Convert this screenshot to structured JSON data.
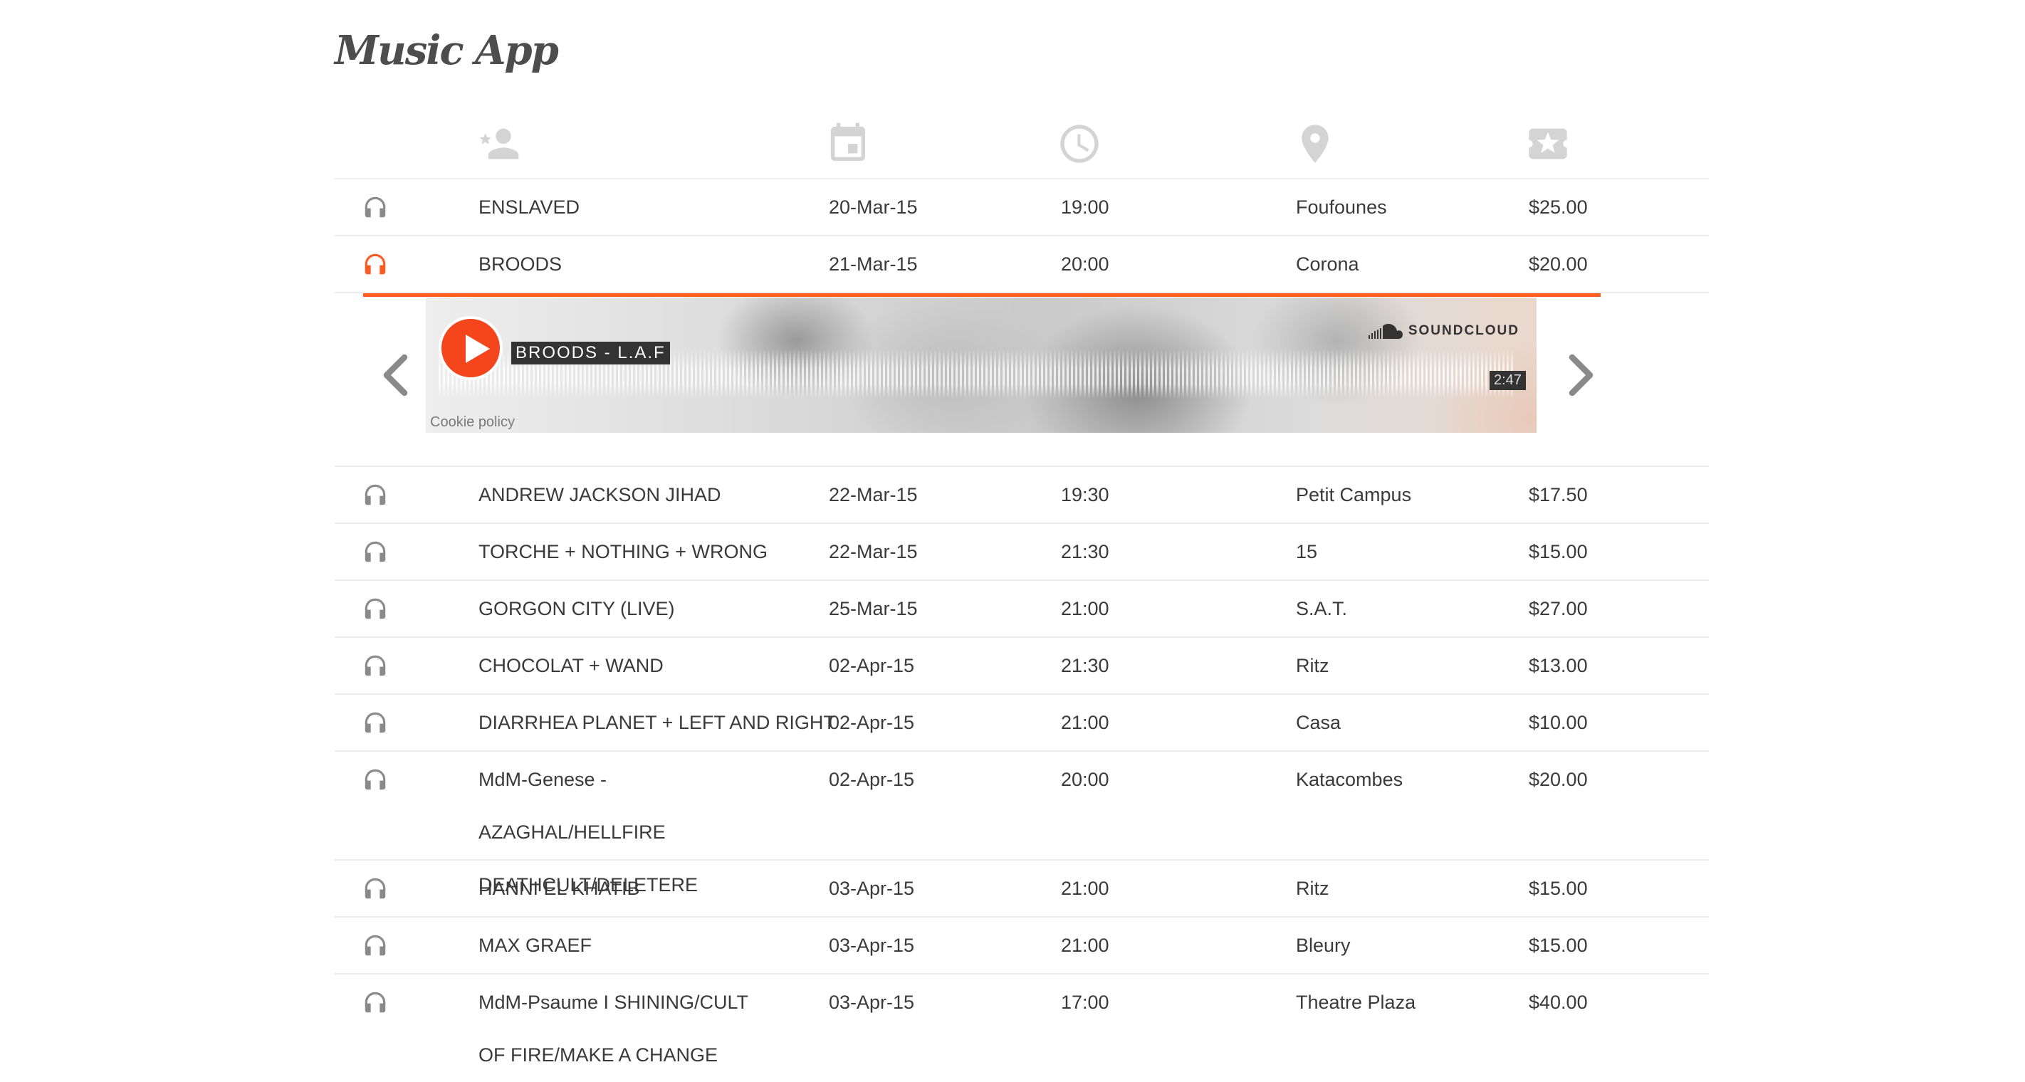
{
  "app": {
    "title": "Music App"
  },
  "header_icons": [
    "person-add-icon",
    "calendar-icon",
    "clock-icon",
    "location-pin-icon",
    "ticket-icon"
  ],
  "colors": {
    "accent": "#ff5a1f",
    "soundcloud_orange": "#f5451d",
    "icon_gray": "#d4d4d4",
    "text": "#3a3a3a"
  },
  "events": [
    {
      "artist": "ENSLAVED",
      "date": "20-Mar-15",
      "time": "19:00",
      "venue": "Foufounes",
      "price": "$25.00"
    },
    {
      "artist": "BROODS",
      "date": "21-Mar-15",
      "time": "20:00",
      "venue": "Corona",
      "price": "$20.00"
    },
    {
      "artist": "ANDREW JACKSON JIHAD",
      "date": "22-Mar-15",
      "time": "19:30",
      "venue": "Petit Campus",
      "price": "$17.50"
    },
    {
      "artist": "TORCHE + NOTHING + WRONG",
      "date": "22-Mar-15",
      "time": "21:30",
      "venue": "15",
      "price": "$15.00"
    },
    {
      "artist": "GORGON CITY (LIVE)",
      "date": "25-Mar-15",
      "time": "21:00",
      "venue": "S.A.T.",
      "price": "$27.00"
    },
    {
      "artist": "CHOCOLAT + WAND",
      "date": "02-Apr-15",
      "time": "21:30",
      "venue": "Ritz",
      "price": "$13.00"
    },
    {
      "artist": "DIARRHEA PLANET + LEFT AND RIGHT",
      "date": "02-Apr-15",
      "time": "21:00",
      "venue": "Casa",
      "price": "$10.00"
    },
    {
      "artist": "MdM-Genese - AZAGHAL/HELLFIRE DEATHCULT/DELETERE",
      "date": "02-Apr-15",
      "time": "20:00",
      "venue": "Katacombes",
      "price": "$20.00"
    },
    {
      "artist": "HANNI EL KHATIB",
      "date": "03-Apr-15",
      "time": "21:00",
      "venue": "Ritz",
      "price": "$15.00"
    },
    {
      "artist": "MAX GRAEF",
      "date": "03-Apr-15",
      "time": "21:00",
      "venue": "Bleury",
      "price": "$15.00"
    },
    {
      "artist": "MdM-Psaume I SHINING/CULT OF FIRE/MAKE A CHANGE",
      "date": "03-Apr-15",
      "time": "17:00",
      "venue": "Theatre Plaza",
      "price": "$40.00"
    }
  ],
  "player": {
    "track_title": "BROODS - L.A.F",
    "brand": "SOUNDCLOUD",
    "duration": "2:47",
    "cookie_policy": "Cookie policy",
    "prev_icon": "chevron-left-icon",
    "next_icon": "chevron-right-icon"
  }
}
